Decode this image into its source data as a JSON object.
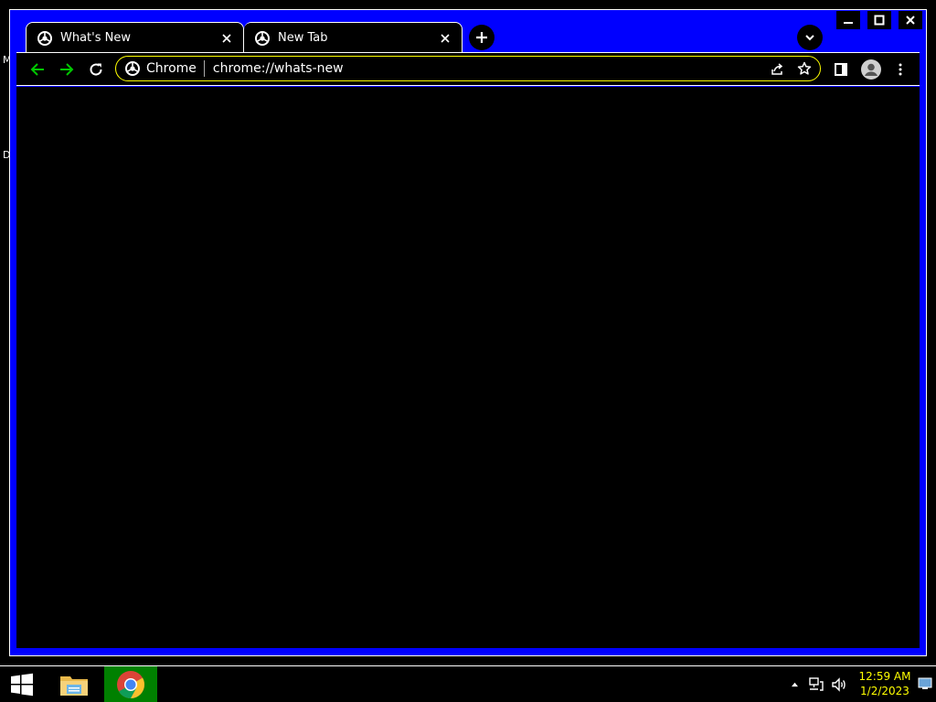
{
  "desktop": {
    "char_m": "M",
    "char_d": "D"
  },
  "window": {
    "controls": [
      "minimize-icon",
      "maximize-icon",
      "close-icon"
    ]
  },
  "tabs": [
    {
      "title": "What's New",
      "active": true,
      "icon": "chrome-favicon"
    },
    {
      "title": "New Tab",
      "active": false,
      "icon": "chrome-favicon"
    }
  ],
  "toolbar": {
    "back_icon": "arrow-left-icon",
    "forward_icon": "arrow-right-icon",
    "reload_icon": "reload-icon",
    "chip_label": "Chrome",
    "url": "chrome://whats-new",
    "share_icon": "share-icon",
    "bookmark_icon": "star-icon",
    "side_panel_icon": "side-panel-icon",
    "profile_icon": "avatar-icon",
    "menu_icon": "kebab-menu-icon"
  },
  "taskbar": {
    "pinned": [
      "windows-start-icon",
      "file-explorer-icon",
      "chrome-icon"
    ],
    "time": "12:59 AM",
    "date": "1/2/2023"
  },
  "colors": {
    "frame": "#0000ff",
    "omnibox_border": "#ffff00",
    "nav_arrows": "#00c800",
    "clock_text": "#ffff00",
    "chrome_taskbar_bg": "#008000"
  }
}
